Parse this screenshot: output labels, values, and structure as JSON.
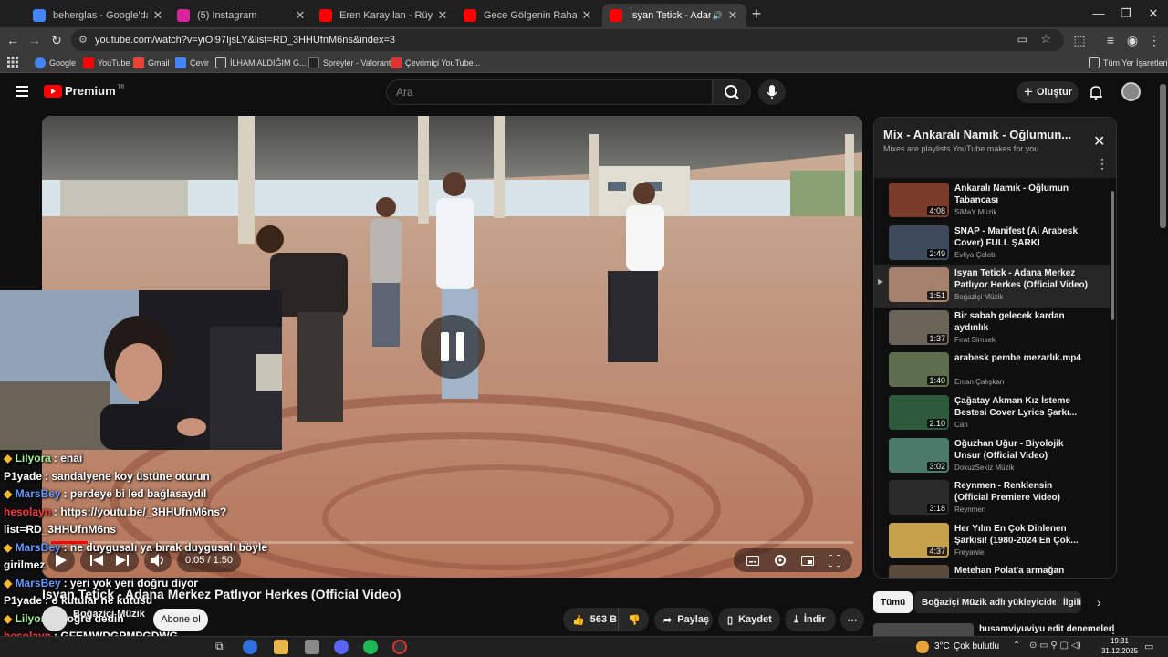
{
  "browser": {
    "tabs": [
      {
        "title": "beherglas - Google'da Ara",
        "icon": "google-icon",
        "color": "#4285f4"
      },
      {
        "title": "(5) Instagram",
        "icon": "instagram-icon",
        "color": "#d6249f"
      },
      {
        "title": "Eren Karayılan - Rüyalara Sor -",
        "icon": "youtube-icon",
        "color": "#ff0000"
      },
      {
        "title": "Gece Gölgenin Rahatına Bak - G",
        "icon": "youtube-icon",
        "color": "#ff0000"
      },
      {
        "title": "Isyan Tetick - Adana Merke:",
        "icon": "youtube-icon",
        "color": "#ff0000",
        "active": true
      }
    ],
    "url": "youtube.com/watch?v=yiOl97IjsLY&list=RD_3HHUfnM6ns&index=3",
    "bookmarks": [
      "Google",
      "YouTube",
      "Gmail",
      "Çevir",
      "İLHAM ALDIĞIM G...",
      "Spreyler - Valorant",
      "Çevrimiçi YouTube...",
      "Tüm Yer İşaretleri"
    ]
  },
  "youtube": {
    "logo": "Premium",
    "logo_sup": "TR",
    "search_placeholder": "Ara",
    "create_label": "Oluştur"
  },
  "player": {
    "time": "0:05 / 1:50",
    "progress": 0.045,
    "state": "paused"
  },
  "video": {
    "title": "Isyan Tetick - Adana Merkez Patlıyor Herkes (Official Video)",
    "channel": "Boğaziçi Müzik",
    "subscribe": "Abone ol",
    "likes": "563 B",
    "share": "Paylaş",
    "save": "Kaydet",
    "download": "İndir"
  },
  "chat": [
    {
      "name": "Lilyora",
      "msg": ": enai",
      "color": "#a7f3a0",
      "badge": true
    },
    {
      "name": "P1yade",
      "msg": ": sandalyene koy üstüne oturun",
      "color": "#ffffff"
    },
    {
      "name": "MarsBey",
      "msg": ": perdeye bi led bağlasaydıl",
      "color": "#6b9bff",
      "badge": true
    },
    {
      "name": "hesolayn",
      "msg": ": https://youtu.be/_3HHUfnM6ns?",
      "color": "#ff3b3b"
    },
    {
      "name": "",
      "msg": "list=RD_3HHUfnM6ns",
      "color": "#ffffff"
    },
    {
      "name": "MarsBey",
      "msg": ": ne duygusalı ya bırak duygusalı böyle",
      "color": "#6b9bff",
      "badge": true
    },
    {
      "name": "",
      "msg": "girilmez",
      "color": "#ffffff"
    },
    {
      "name": "MarsBey",
      "msg": ": yeri yok yeri doğru diyor",
      "color": "#6b9bff",
      "badge": true
    },
    {
      "name": "P1yade",
      "msg": ": o kutular ne kutusu",
      "color": "#ffffff"
    },
    {
      "name": "Lilyora",
      "msg": ": doğru dedin",
      "color": "#a7f3a0",
      "badge": true
    },
    {
      "name": "hesolayn",
      "msg": ": GFEMWDGPMPGDWG",
      "color": "#ff3b3b"
    }
  ],
  "playlist": {
    "title": "Mix - Ankaralı Namık - Oğlumun...",
    "subtitle": "Mixes are playlists YouTube makes for you",
    "items": [
      {
        "title": "Ankaralı Namık - Oğlumun Tabancası",
        "channel": "SiMaY Müzik",
        "duration": "4:08",
        "thumb": "#7a3b2a"
      },
      {
        "title": "SNAP - Manifest (Ai Arabesk Cover) FULL ŞARKI",
        "channel": "Evliya Çelebi",
        "duration": "2:49",
        "thumb": "#3c4a5a"
      },
      {
        "title": "Isyan Tetick - Adana Merkez Patlıyor Herkes (Official Video)",
        "channel": "Boğaziçi Müzik",
        "duration": "1:51",
        "thumb": "#a5806a",
        "current": true
      },
      {
        "title": "Bir sabah gelecek kardan aydınlık",
        "channel": "Fırat Simsek",
        "duration": "1:37",
        "thumb": "#6a6357"
      },
      {
        "title": "arabesk pembe mezarlık.mp4",
        "channel": "Ercan Çalışkan",
        "duration": "1:40",
        "thumb": "#5d6e4c"
      },
      {
        "title": "Çağatay Akman Kız İsteme Bestesi Cover Lyrics Şarkı...",
        "channel": "Can",
        "duration": "2:10",
        "thumb": "#2d5a3a"
      },
      {
        "title": "Oğuzhan Uğur - Biyolojik Unsur (Official Video)",
        "channel": "DokuzSekiz Müzik",
        "duration": "3:02",
        "thumb": "#4a7a6a"
      },
      {
        "title": "Reynmen - Renklensin (Official Premiere Video)",
        "channel": "Reynmen",
        "duration": "3:18",
        "thumb": "#2a2a2a"
      },
      {
        "title": "Her Yılın En Çok Dinlenen Şarkısı! (1980-2024 En Çok...",
        "channel": "Freyawie",
        "duration": "4:37",
        "thumb": "#c8a24a"
      },
      {
        "title": "Metehan Polat'a armağan",
        "channel": "",
        "duration": "",
        "thumb": "#5a4a3a"
      }
    ]
  },
  "chips": [
    "Tümü",
    "Boğaziçi Müzik adlı yükleyiciden",
    "İlgili"
  ],
  "related": {
    "title": "husamviyuviyu edit denemeleri"
  },
  "taskbar": {
    "weather": "3°C",
    "weather_text": "Çok bulutlu",
    "time": "19:31",
    "date": "31.12.2025"
  }
}
